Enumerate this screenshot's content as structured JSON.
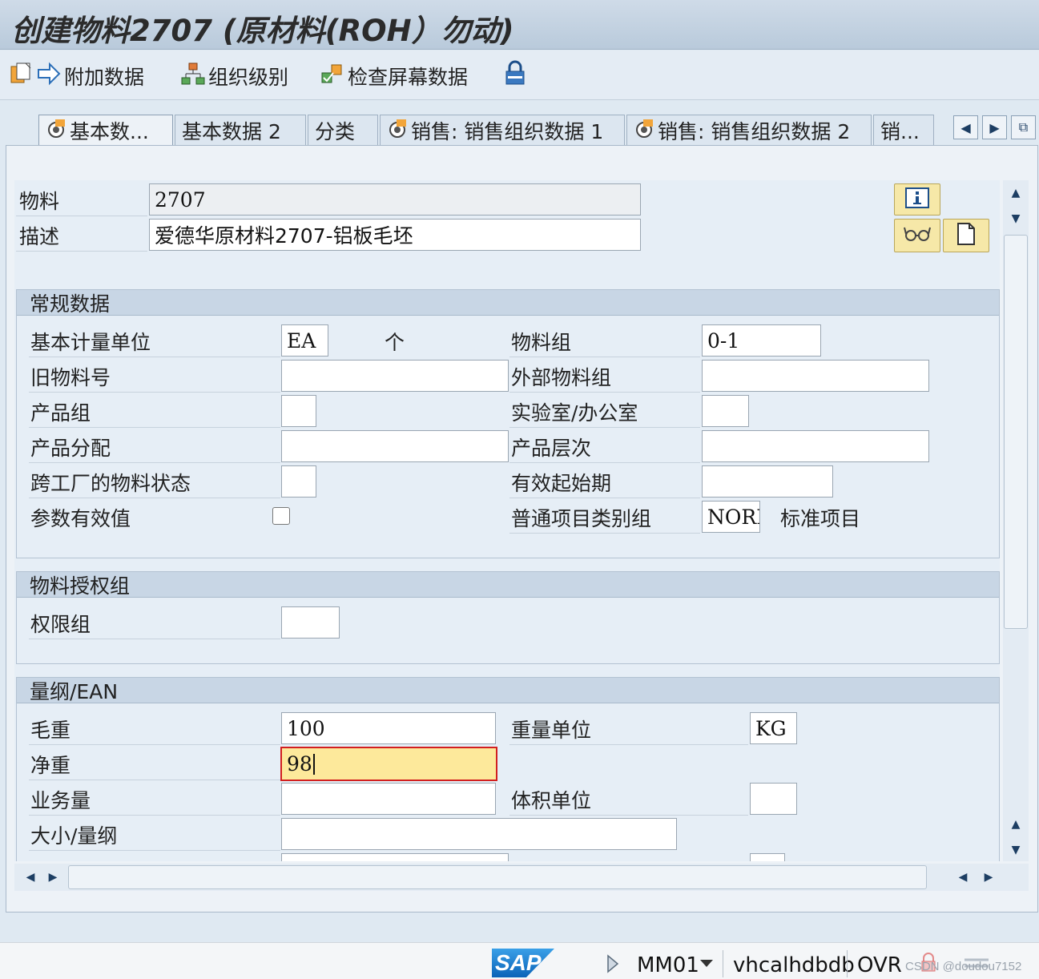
{
  "window": {
    "title": "创建物料2707 (原材料(ROH）勿动)"
  },
  "toolbar": {
    "additional_data": "附加数据",
    "org_levels": "组织级别",
    "check_screen": "检查屏幕数据"
  },
  "tabs": [
    {
      "label": "基本数...",
      "active": true
    },
    {
      "label": "基本数据 2"
    },
    {
      "label": "分类"
    },
    {
      "label": "销售: 销售组织数据 1"
    },
    {
      "label": "销售: 销售组织数据 2"
    },
    {
      "label": "销..."
    }
  ],
  "header": {
    "material_label": "物料",
    "material_value": "2707",
    "desc_label": "描述",
    "desc_value": "爱德华原材料2707-铝板毛坯"
  },
  "general": {
    "title": "常规数据",
    "base_uom_label": "基本计量单位",
    "base_uom_value": "EA",
    "base_uom_text": "个",
    "mat_group_label": "物料组",
    "mat_group_value": "0-1",
    "old_mat_label": "旧物料号",
    "old_mat_value": "",
    "ext_mat_group_label": "外部物料组",
    "ext_mat_group_value": "",
    "division_label": "产品组",
    "division_value": "",
    "lab_office_label": "实验室/办公室",
    "lab_office_value": "",
    "prod_alloc_label": "产品分配",
    "prod_alloc_value": "",
    "prod_hier_label": "产品层次",
    "prod_hier_value": "",
    "xplant_status_label": "跨工厂的物料状态",
    "xplant_status_value": "",
    "valid_from_label": "有效起始期",
    "valid_from_value": "",
    "param_eff_label": "参数有效值",
    "param_eff_checked": false,
    "item_cat_label": "普通项目类别组",
    "item_cat_value": "NORM",
    "item_cat_text": "标准项目"
  },
  "auth": {
    "title": "物料授权组",
    "auth_group_label": "权限组",
    "auth_group_value": ""
  },
  "dims": {
    "title": "量纲/EAN",
    "gross_label": "毛重",
    "gross_value": "100",
    "weight_unit_label": "重量单位",
    "weight_unit_value": "KG",
    "net_label": "净重",
    "net_value": "98",
    "volume_label": "业务量",
    "volume_value": "",
    "volume_unit_label": "体积单位",
    "volume_unit_value": "",
    "size_label": "大小/量纲",
    "size_value": ""
  },
  "status": {
    "sap": "SAP",
    "tcode": "MM01",
    "server": "vhcalhdbdb",
    "mode": "OVR",
    "watermark": "CSDN @doudou7152"
  }
}
